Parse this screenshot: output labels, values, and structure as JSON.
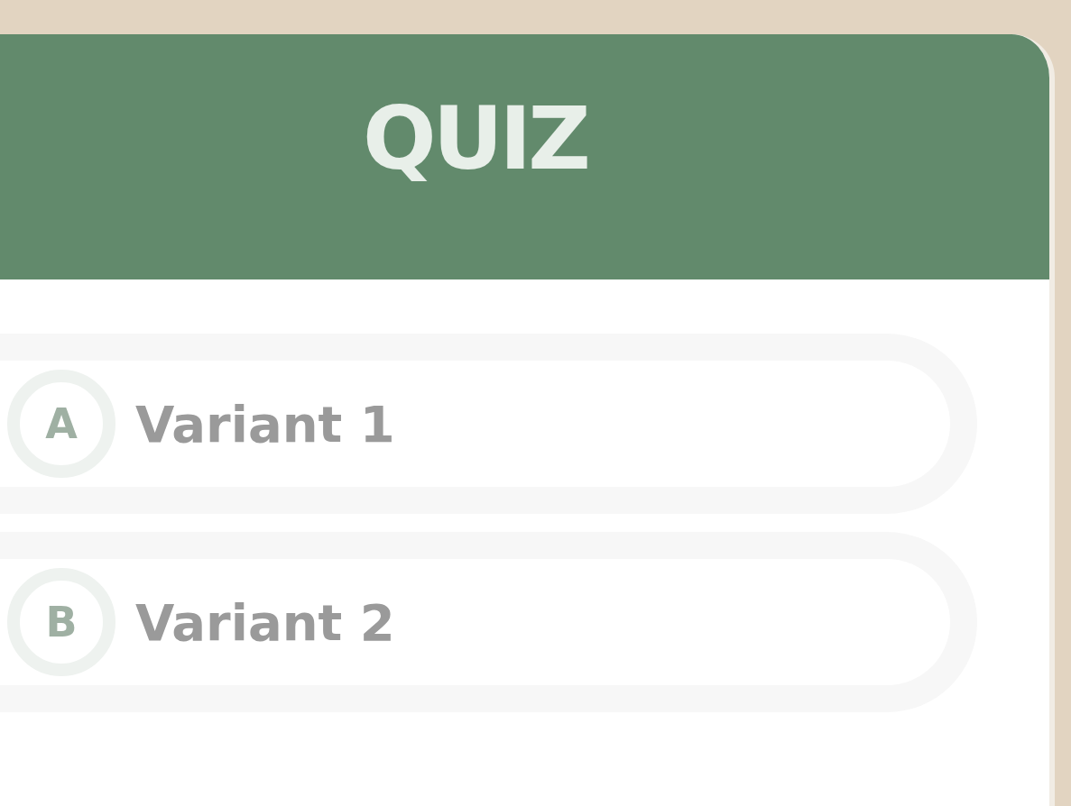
{
  "quiz": {
    "title": "QUIZ",
    "options": [
      {
        "letter": "A",
        "label": "Variant 1",
        "selected": false
      },
      {
        "letter": "B",
        "label": "Variant 2",
        "selected": false
      }
    ]
  }
}
